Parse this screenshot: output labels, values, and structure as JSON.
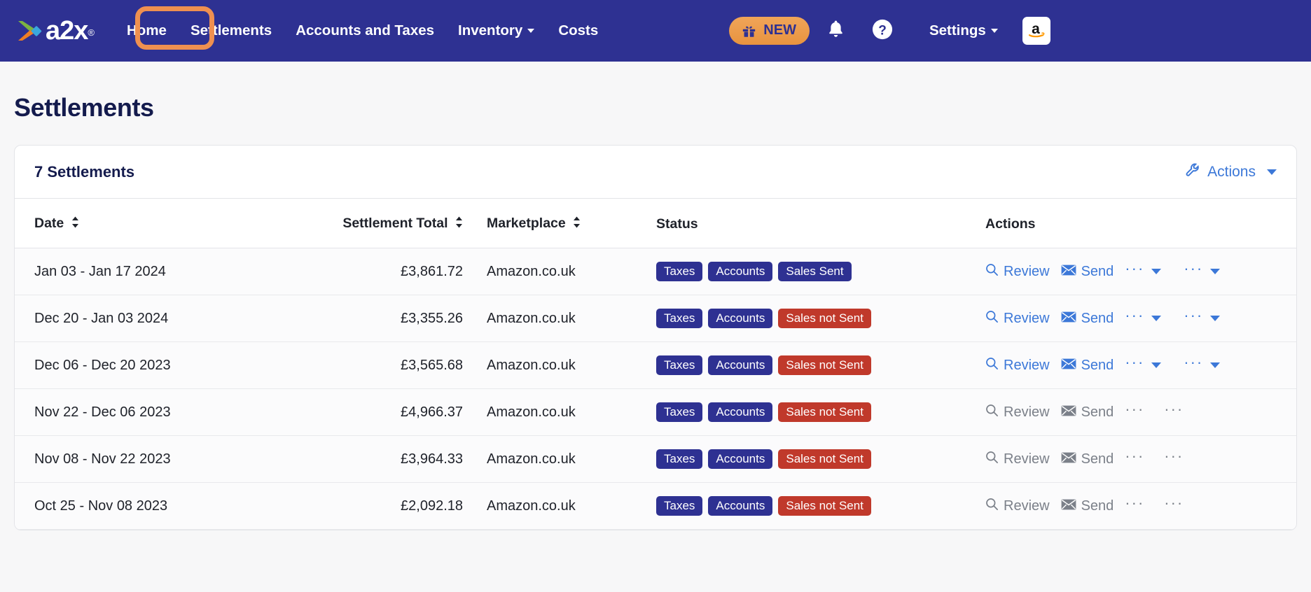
{
  "navbar": {
    "brand": {
      "word": "a2x",
      "registered": "®",
      "logo_icon": "a2x-chevron-logo"
    },
    "links": [
      {
        "label": "Home",
        "has_caret": false
      },
      {
        "label": "Settlements",
        "has_caret": false
      },
      {
        "label": "Accounts and Taxes",
        "has_caret": false
      },
      {
        "label": "Inventory",
        "has_caret": true
      },
      {
        "label": "Costs",
        "has_caret": false
      }
    ],
    "new_badge": {
      "label": "NEW",
      "icon": "gift-icon"
    },
    "notifications_icon": "bell-icon",
    "help_icon": "question-circle-icon",
    "settings": {
      "label": "Settings",
      "has_caret": true
    },
    "marketplace_tile": {
      "icon": "amazon-icon",
      "letter": "a"
    }
  },
  "page": {
    "title": "Settlements"
  },
  "card": {
    "title": "7 Settlements",
    "actions": {
      "label": "Actions",
      "icon": "wrench-icon",
      "caret": true
    }
  },
  "table": {
    "columns": [
      {
        "label": "Date",
        "sortable": true
      },
      {
        "label": "Settlement Total",
        "sortable": true
      },
      {
        "label": "Marketplace",
        "sortable": true
      },
      {
        "label": "Status",
        "sortable": false
      },
      {
        "label": "Actions",
        "sortable": false
      }
    ],
    "action_labels": {
      "review": "Review",
      "send": "Send",
      "review_icon": "magnifier-icon",
      "send_icon": "envelope-icon",
      "more_dots": "···"
    },
    "rows": [
      {
        "date": "Jan 03 - Jan 17 2024",
        "total": "£3,861.72",
        "marketplace": "Amazon.co.uk",
        "badges": [
          {
            "label": "Taxes",
            "color": "blue"
          },
          {
            "label": "Accounts",
            "color": "blue"
          },
          {
            "label": "Sales Sent",
            "color": "blue"
          }
        ],
        "enabled": true
      },
      {
        "date": "Dec 20 - Jan 03 2024",
        "total": "£3,355.26",
        "marketplace": "Amazon.co.uk",
        "badges": [
          {
            "label": "Taxes",
            "color": "blue"
          },
          {
            "label": "Accounts",
            "color": "blue"
          },
          {
            "label": "Sales not Sent",
            "color": "red"
          }
        ],
        "enabled": true
      },
      {
        "date": "Dec 06 - Dec 20 2023",
        "total": "£3,565.68",
        "marketplace": "Amazon.co.uk",
        "badges": [
          {
            "label": "Taxes",
            "color": "blue"
          },
          {
            "label": "Accounts",
            "color": "blue"
          },
          {
            "label": "Sales not Sent",
            "color": "red"
          }
        ],
        "enabled": true
      },
      {
        "date": "Nov 22 - Dec 06 2023",
        "total": "£4,966.37",
        "marketplace": "Amazon.co.uk",
        "badges": [
          {
            "label": "Taxes",
            "color": "blue"
          },
          {
            "label": "Accounts",
            "color": "blue"
          },
          {
            "label": "Sales not Sent",
            "color": "red"
          }
        ],
        "enabled": false
      },
      {
        "date": "Nov 08 - Nov 22 2023",
        "total": "£3,964.33",
        "marketplace": "Amazon.co.uk",
        "badges": [
          {
            "label": "Taxes",
            "color": "blue"
          },
          {
            "label": "Accounts",
            "color": "blue"
          },
          {
            "label": "Sales not Sent",
            "color": "red"
          }
        ],
        "enabled": false
      },
      {
        "date": "Oct 25 - Nov 08 2023",
        "total": "£2,092.18",
        "marketplace": "Amazon.co.uk",
        "badges": [
          {
            "label": "Taxes",
            "color": "blue"
          },
          {
            "label": "Accounts",
            "color": "blue"
          },
          {
            "label": "Sales not Sent",
            "color": "red"
          }
        ],
        "enabled": false
      }
    ]
  },
  "annotations": [
    {
      "name": "nav-settlements-highlight",
      "target": "Settlements"
    },
    {
      "name": "row2-review-highlight",
      "target": "Review"
    }
  ],
  "colors": {
    "brand_navy": "#2e3192",
    "accent_orange": "#ef9050",
    "link_blue": "#3c78d8",
    "danger_red": "#c0392b",
    "page_bg": "#f7f7f8",
    "title_navy": "#141b4d"
  }
}
